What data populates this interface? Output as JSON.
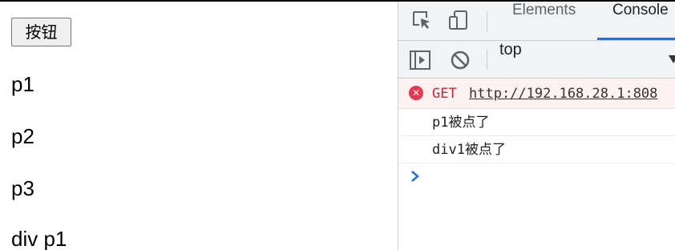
{
  "page": {
    "button_label": "按钮",
    "paragraphs": [
      "p1",
      "p2",
      "p3",
      "div p1"
    ]
  },
  "devtools": {
    "tabs": [
      {
        "label": "Elements",
        "active": false
      },
      {
        "label": "Console",
        "active": true
      }
    ],
    "toolbar": {
      "context": "top"
    },
    "console": {
      "error": {
        "method": "GET",
        "url": "http://192.168.28.1:808"
      },
      "logs": [
        "p1被点了",
        "div1被点了"
      ]
    }
  },
  "colors": {
    "tab_underline": "#1a73e8",
    "error_text": "#e01e2b",
    "error_background": "#fdf2f2",
    "prompt": "#1a73e8"
  }
}
